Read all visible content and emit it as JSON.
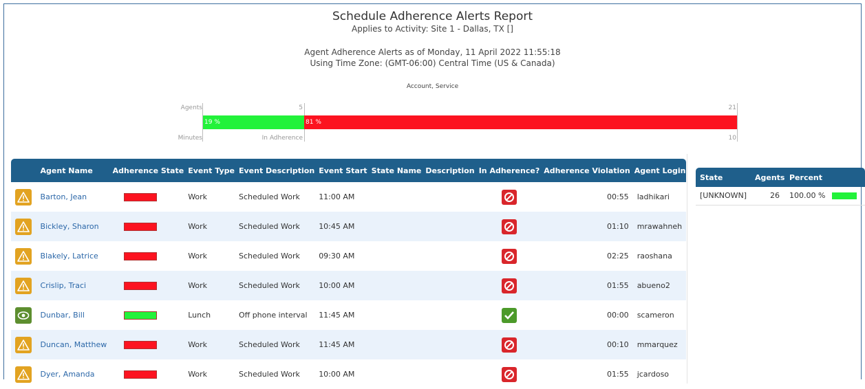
{
  "report": {
    "title": "Schedule Adherence Alerts Report",
    "activity": "Applies to Activity: Site 1 - Dallas, TX []",
    "as_of": "Agent Adherence Alerts as of Monday, 11 April 2022 11:55:18",
    "timezone": "Using Time Zone: (GMT-06:00) Central Time (US & Canada)",
    "grouping": "Account, Service"
  },
  "summary_bar": {
    "agents_label": "Agents",
    "minutes_label": "Minutes",
    "in_adherence_label": "In Adherence",
    "agents_in": "5",
    "agents_total": "21",
    "minutes_total": "10",
    "in_pct_label": "19 %",
    "out_pct_label": "81 %",
    "in_fraction": 0.19,
    "in_color": "#22f23a",
    "out_color": "#fc1320"
  },
  "table": {
    "headers": [
      "",
      "Agent Name",
      "Adherence State",
      "Event Type",
      "Event Description",
      "Event Start",
      "State Name",
      "Description",
      "In Adherence?",
      "Adherence Violation",
      "Agent Login"
    ],
    "rows": [
      {
        "icon": "warning-icon",
        "name": "Barton, Jean",
        "state_color": "#fc1320",
        "event_type": "Work",
        "event_desc": "Scheduled Work",
        "event_start": "11:00 AM",
        "state_name": "",
        "description": "",
        "in_adherence": false,
        "violation": "00:55",
        "login": "ladhikari"
      },
      {
        "icon": "warning-icon",
        "name": "Bickley, Sharon",
        "state_color": "#fc1320",
        "event_type": "Work",
        "event_desc": "Scheduled Work",
        "event_start": "10:45 AM",
        "state_name": "",
        "description": "",
        "in_adherence": false,
        "violation": "01:10",
        "login": "mrawahneh"
      },
      {
        "icon": "warning-icon",
        "name": "Blakely, Latrice",
        "state_color": "#fc1320",
        "event_type": "Work",
        "event_desc": "Scheduled Work",
        "event_start": "09:30 AM",
        "state_name": "",
        "description": "",
        "in_adherence": false,
        "violation": "02:25",
        "login": "raoshana"
      },
      {
        "icon": "warning-icon",
        "name": "Crislip, Traci",
        "state_color": "#fc1320",
        "event_type": "Work",
        "event_desc": "Scheduled Work",
        "event_start": "10:00 AM",
        "state_name": "",
        "description": "",
        "in_adherence": false,
        "violation": "01:55",
        "login": "abueno2"
      },
      {
        "icon": "eye-icon",
        "name": "Dunbar, Bill",
        "state_color": "#22f23a",
        "event_type": "Lunch",
        "event_desc": "Off phone interval",
        "event_start": "11:45 AM",
        "state_name": "",
        "description": "",
        "in_adherence": true,
        "violation": "00:00",
        "login": "scameron"
      },
      {
        "icon": "warning-icon",
        "name": "Duncan, Matthew",
        "state_color": "#fc1320",
        "event_type": "Work",
        "event_desc": "Scheduled Work",
        "event_start": "11:45 AM",
        "state_name": "",
        "description": "",
        "in_adherence": false,
        "violation": "00:10",
        "login": "mmarquez"
      },
      {
        "icon": "warning-icon",
        "name": "Dyer, Amanda",
        "state_color": "#fc1320",
        "event_type": "Work",
        "event_desc": "Scheduled Work",
        "event_start": "10:00 AM",
        "state_name": "",
        "description": "",
        "in_adherence": false,
        "violation": "01:55",
        "login": "jcardoso"
      }
    ]
  },
  "state_summary": {
    "headers": [
      "State",
      "Agents",
      "Percent"
    ],
    "rows": [
      {
        "state": "[UNKNOWN]",
        "agents": "26",
        "percent": "100.00 %",
        "fraction": 1.0,
        "bar_color": "#22f23a"
      }
    ]
  }
}
